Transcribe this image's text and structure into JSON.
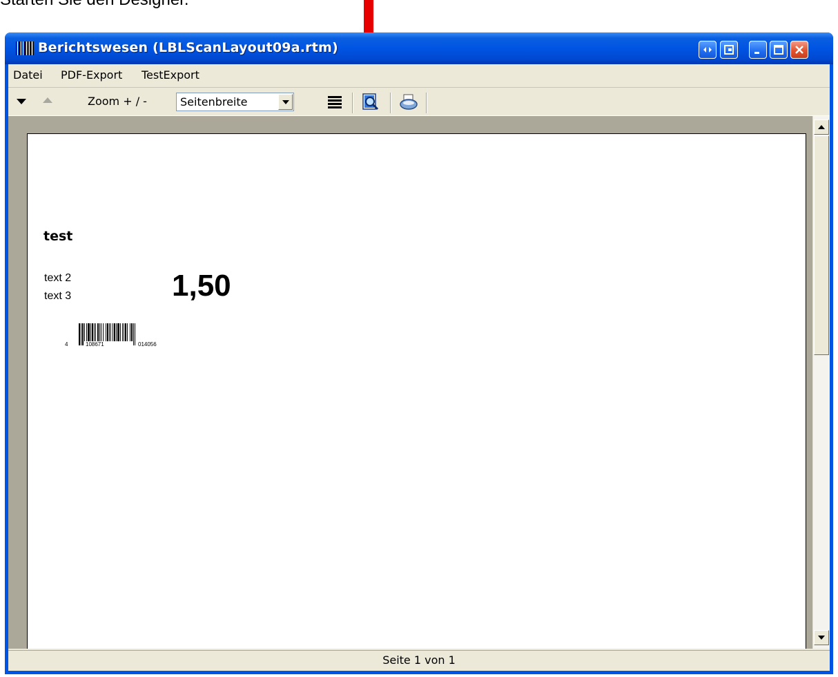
{
  "caption": "Starten Sie den Designer.",
  "window": {
    "title": "Berichtswesen (LBLScanLayout09a.rtm)",
    "app_icon": "barcode-icon",
    "controls": [
      "restore-special-icon",
      "tile-icon",
      "minimize-icon",
      "maximize-icon",
      "close-icon"
    ]
  },
  "menu": [
    "Datei",
    "PDF-Export",
    "TestExport"
  ],
  "toolbar": {
    "zoom_label": "Zoom + / -",
    "zoom_select": "Seitenbreite",
    "icons": [
      "next-page-icon",
      "previous-page-icon",
      "outline-icon",
      "designer-icon",
      "print-icon"
    ]
  },
  "report_page": {
    "heading": "test",
    "line2": "text 2",
    "line3": "text 3",
    "amount": "1,50",
    "barcode_text": "4 108671 014056"
  },
  "status": "Seite 1 von 1",
  "colors": {
    "titlebar": "#0054e3",
    "face": "#ece9d8",
    "workspace": "#aca899",
    "close_button": "#e2532f",
    "arrow": "#e60000"
  }
}
